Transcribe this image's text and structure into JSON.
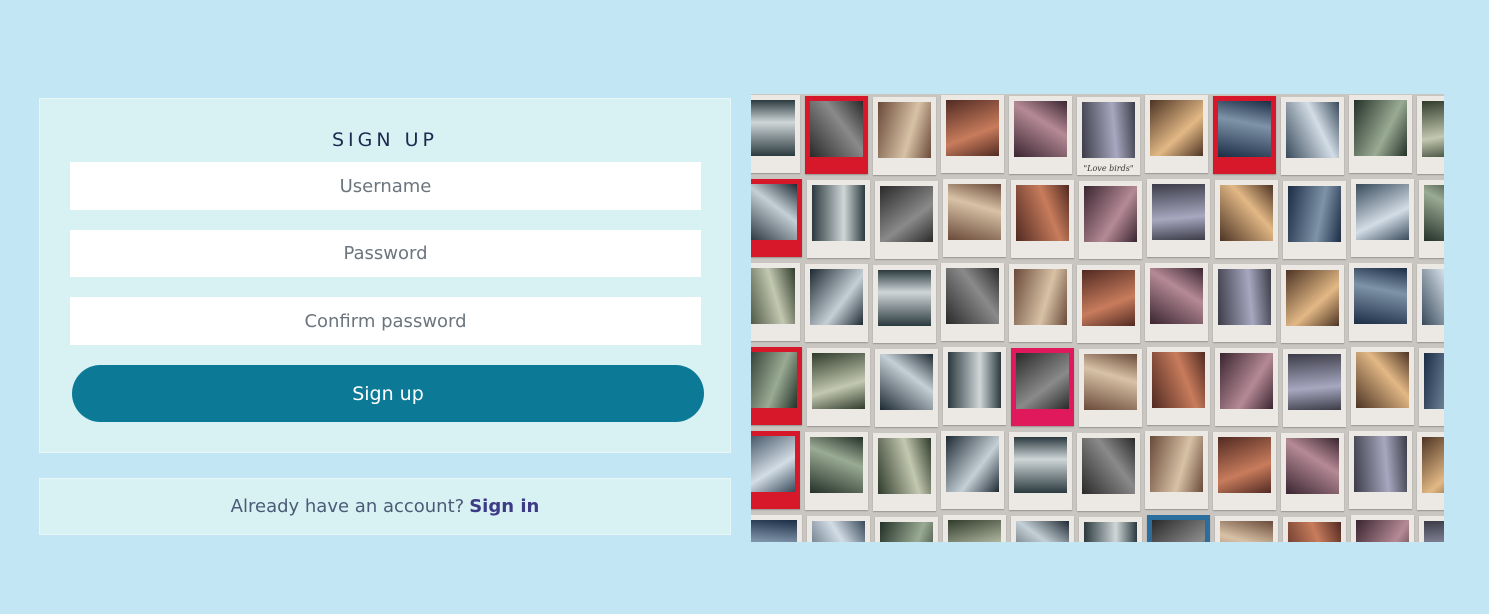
{
  "signup": {
    "title": "SIGN UP",
    "username_placeholder": "Username",
    "password_placeholder": "Password",
    "confirm_placeholder": "Confirm password",
    "button_label": "Sign up"
  },
  "signin": {
    "prompt": "Already have an account?",
    "link_label": "Sign in"
  },
  "photo_wall": {
    "caption": "\"Love birds\""
  },
  "colors": {
    "page_background": "#c3e6f5",
    "card_background": "#d8f2f4",
    "primary_button": "#0c7a96",
    "title_text": "#1d2a4f",
    "link_text": "#3d3a86"
  }
}
